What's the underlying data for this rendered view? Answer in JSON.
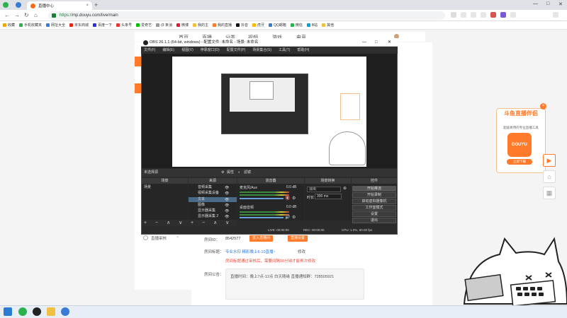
{
  "browser": {
    "tab_title": "直播中心",
    "url_prefix": "https://",
    "url_rest": "mp.douyu.com/live/main",
    "bookmarks": [
      "收藏",
      "手机收藏夹",
      "网址大全",
      "京东商城",
      "百度一下",
      "头条号",
      "爱奇艺",
      "(9 条消",
      "微博",
      "我的主",
      "我的直播",
      "抖音",
      "虎牙",
      "QQ邮箱",
      "微信",
      "B站",
      "其他"
    ]
  },
  "site": {
    "nav_items": [
      "首页",
      "直播",
      "分类",
      "视频",
      "游戏",
      "电竞"
    ],
    "room_id_label": "房间ID：",
    "room_id_value": "8542577",
    "enter_room_btn": "进入直播间",
    "live_settings_btn": "直播设置",
    "room_title_label": "房间标题：",
    "room_title_link": "专业水印 精彩晚上6-10直播~",
    "edit_label": "修改",
    "room_title_warning": "房间标题通过审核后，需要间隔10分钟才能再次修改",
    "notice_label": "房间公告：",
    "notice_text": "直播时间：晚上7点-12点 白天随缘 直播通知群：728505921",
    "side_item": "直播审核"
  },
  "promo": {
    "title": "斗鱼直播伴侣",
    "subtitle": "超级易用的专业直播工具",
    "logo_text": "DOUYU",
    "download_btn": "立即下载",
    "close_symbol": "×"
  },
  "side_buttons": [
    "▶",
    "⌂",
    "▦"
  ],
  "obs": {
    "title": "OBS 26.1.1 (64-bit, windows) - 配置文件: 未命名 - 场景: 未命名",
    "menu": [
      "文件(F)",
      "编辑(E)",
      "视图(V)",
      "停靠窗口(D)",
      "配置文件(P)",
      "场景集合(S)",
      "工具(T)",
      "帮助(H)"
    ],
    "scene_bar_label": "未选择源",
    "scene_bar_properties": "属性",
    "scene_bar_filters": "滤镜",
    "dock_titles": [
      "场景",
      "来源",
      "混音器",
      "场景转换",
      "控件"
    ],
    "scenes": [
      "场景"
    ],
    "sources": [
      "音频采集",
      "视频采集设备",
      "文本",
      "图像",
      "显示器采集",
      "显示器采集 2"
    ],
    "mixer": [
      {
        "name": "麦克风/Aux",
        "level": "0.0 dB"
      },
      {
        "name": "桌面音频",
        "level": "0.0 dB"
      }
    ],
    "transition": {
      "type": "淡出",
      "duration_label": "时长",
      "duration_value": "300 ms"
    },
    "controls": [
      "开始推流",
      "开始录制",
      "启动虚拟摄像机",
      "工作室模式",
      "设置",
      "退出"
    ],
    "dock_tools": "+ − ∧ ∨",
    "status": {
      "live": "LIVE: 00:00:00",
      "rec": "REC: 00:00:00",
      "cpu": "CPU: 1.0%, 60.00 fps"
    },
    "window_controls": [
      "—",
      "□",
      "✕"
    ]
  },
  "taskbar": {
    "start_icon": "windows-start-icon"
  },
  "colors": {
    "accent_orange": "#ff7a2a",
    "obs_dark": "#2b2b2b",
    "link_blue": "#2a7ae2",
    "warn_red": "#e74c3c"
  }
}
